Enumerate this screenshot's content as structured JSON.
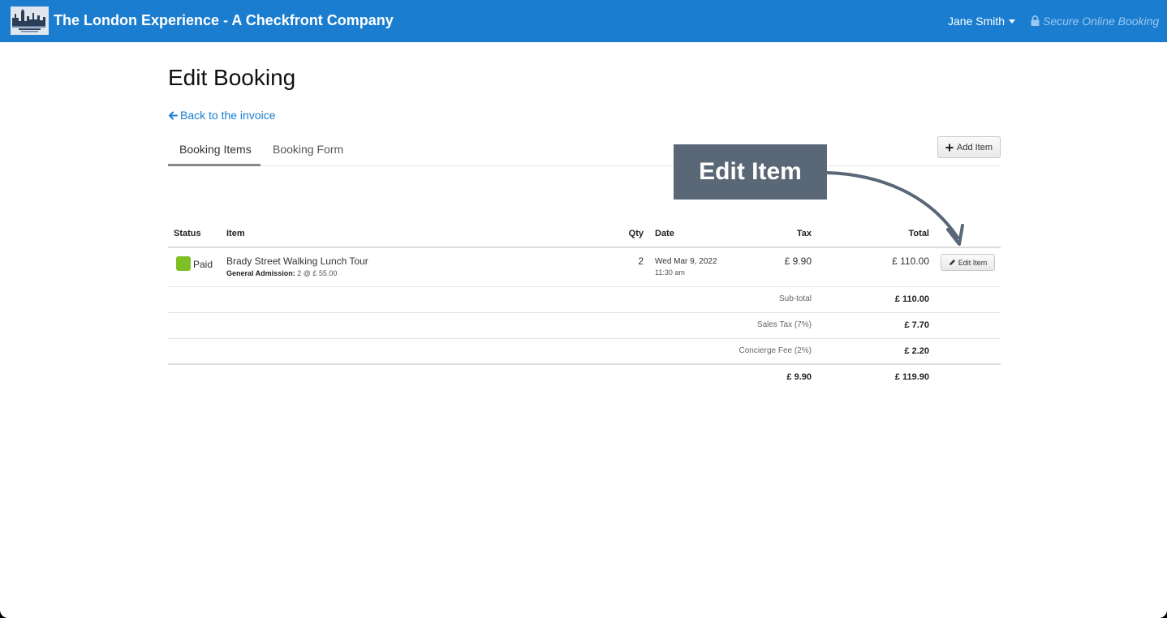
{
  "header": {
    "brand": "The London Experience - A Checkfront Company",
    "user": "Jane Smith",
    "secure_text": "Secure Online Booking",
    "bar_color": "#1a7dd0"
  },
  "page": {
    "title": "Edit Booking",
    "back_link": "Back to the invoice",
    "tabs": [
      {
        "label": "Booking Items",
        "active": true
      },
      {
        "label": "Booking Form",
        "active": false
      }
    ],
    "add_item_label": "Add Item",
    "callout": "Edit Item"
  },
  "table": {
    "headers": [
      "Status",
      "Item",
      "Qty",
      "Date",
      "Tax",
      "Total"
    ],
    "rows": [
      {
        "status": "Paid",
        "status_color": "#7ebf26",
        "item": "Brady Street Walking Lunch Tour",
        "detail_label": "General Admission:",
        "detail_value": "2 @ £ 55.00",
        "qty": "2",
        "date": "Wed Mar 9, 2022",
        "time": "11:30 am",
        "tax": "£ 9.90",
        "total": "£ 110.00",
        "edit_label": "Edit Item"
      }
    ],
    "summary": [
      {
        "label": "Sub-total",
        "value": "£ 110.00"
      },
      {
        "label": "Sales Tax (7%)",
        "value": "£ 7.70"
      },
      {
        "label": "Concierge Fee (2%)",
        "value": "£ 2.20"
      }
    ],
    "grand": {
      "tax": "£ 9.90",
      "total": "£ 119.90"
    }
  }
}
